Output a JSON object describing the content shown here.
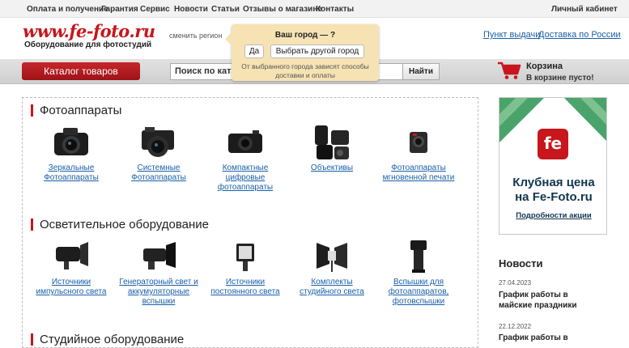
{
  "topnav": {
    "items": [
      "Оплата и получение",
      "Гарантия",
      "Сервис",
      "Новости",
      "Статьи",
      "Отзывы о магазине",
      "Контакты"
    ],
    "cabinet": "Личный кабинет"
  },
  "header": {
    "logo": "www.fe-foto.ru",
    "tagline": "Оборудование для фотостудий",
    "change_region": "сменить регион",
    "pickup_link": "Пункт выдачи",
    "delivery_link": "Доставка по России"
  },
  "city_popup": {
    "question": "Ваш город — ?",
    "yes": "Да",
    "other": "Выбрать другой город",
    "note": "От выбранного города зависят способы доставки и оплаты"
  },
  "bar": {
    "catalog_button": "Каталог товаров",
    "search_value": "Поиск по катало",
    "search_button": "Найти",
    "cart_title": "Корзина",
    "cart_status": "В корзине пусто!"
  },
  "sections": [
    {
      "title": "Фотоаппараты",
      "products": [
        {
          "label": "Зеркальные Фотоаппараты",
          "icon": "dslr-camera-icon"
        },
        {
          "label": "Системные Фотоаппараты",
          "icon": "mirrorless-camera-icon"
        },
        {
          "label": "Компактные цифровые фотоаппараты",
          "icon": "compact-camera-icon"
        },
        {
          "label": "Объективы",
          "icon": "lenses-icon"
        },
        {
          "label": "Фотоаппараты мгновенной печати",
          "icon": "instant-camera-icon"
        }
      ]
    },
    {
      "title": "Осветительное оборудование",
      "products": [
        {
          "label": "Источники импульсного света",
          "icon": "monolight-icon"
        },
        {
          "label": "Генераторный свет и аккумуляторные вспышки",
          "icon": "battery-flash-icon"
        },
        {
          "label": "Источники постоянного света",
          "icon": "led-panel-icon"
        },
        {
          "label": "Комплекты студийного света",
          "icon": "softbox-kit-icon"
        },
        {
          "label": "Вспышки для фотоаппаратов, фотовспышки",
          "icon": "speedlight-icon"
        }
      ]
    },
    {
      "title": "Студийное оборудование",
      "products": []
    }
  ],
  "banner": {
    "badge": "fe",
    "headline_1": "Клубная цена",
    "headline_2": "на Fe-Foto.ru",
    "more_link": "Подробности акции"
  },
  "news": {
    "title": "Новости",
    "items": [
      {
        "date": "27.04.2023",
        "text": "График работы в майские праздники"
      },
      {
        "date": "22.12.2022",
        "text": "График работы в"
      }
    ]
  },
  "colors": {
    "brand_red": "#c8161d",
    "link_blue": "#1a5fa8",
    "popup_bg": "#f6e2b3",
    "banner_green": "#4aa36b"
  }
}
